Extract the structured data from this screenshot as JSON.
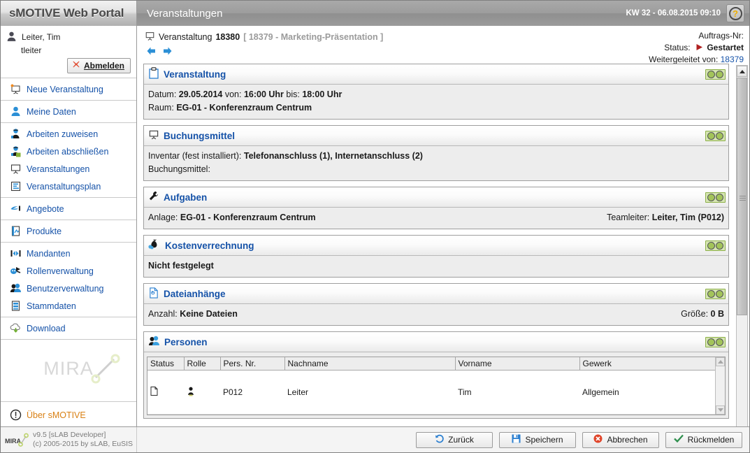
{
  "header": {
    "brand": "sMOTIVE Web Portal",
    "page_title": "Veranstaltungen",
    "datetime": "KW 32 - 06.08.2015 09:10",
    "help_glyph": "?"
  },
  "sidebar": {
    "user": {
      "name": "Leiter, Tim",
      "login": "tleiter",
      "logout_label": "Abmelden"
    },
    "groups": [
      {
        "items": [
          {
            "label": "Neue Veranstaltung",
            "icon": "new-presentation-icon"
          }
        ]
      },
      {
        "items": [
          {
            "label": "Meine Daten",
            "icon": "user-icon"
          }
        ]
      },
      {
        "items": [
          {
            "label": "Arbeiten zuweisen",
            "icon": "worker-assign-icon"
          },
          {
            "label": "Arbeiten abschließen",
            "icon": "worker-complete-icon"
          },
          {
            "label": "Veranstaltungen",
            "icon": "presentation-icon"
          },
          {
            "label": "Veranstaltungsplan",
            "icon": "plan-icon"
          }
        ]
      },
      {
        "items": [
          {
            "label": "Angebote",
            "icon": "offer-icon"
          }
        ]
      },
      {
        "items": [
          {
            "label": "Produkte",
            "icon": "product-icon"
          }
        ]
      },
      {
        "items": [
          {
            "label": "Mandanten",
            "icon": "client-icon"
          },
          {
            "label": "Rollenverwaltung",
            "icon": "roles-icon"
          },
          {
            "label": "Benutzerverwaltung",
            "icon": "users-icon"
          },
          {
            "label": "Stammdaten",
            "icon": "masterdata-icon"
          }
        ]
      },
      {
        "items": [
          {
            "label": "Download",
            "icon": "download-icon"
          }
        ]
      }
    ],
    "watermark": "MIRA",
    "about": {
      "label": "Über sMOTIVE",
      "icon": "info-icon"
    }
  },
  "breadcrumb": {
    "prefix": "Veranstaltung",
    "id": "18380",
    "context": "[ 18379 - Marketing-Präsentation ]"
  },
  "meta": {
    "order_label": "Auftrags-Nr:",
    "order_value": "",
    "status_label": "Status:",
    "status_value": "Gestartet",
    "forwarded_label": "Weitergeleitet von:",
    "forwarded_value": "18379"
  },
  "panels": [
    {
      "key": "veranstaltung",
      "title": "Veranstaltung",
      "icon": "clipboard-icon",
      "toggle": "og-toggle-icon",
      "lines": [
        {
          "type": "kv-multi",
          "parts": [
            {
              "label": "Datum:",
              "value": "29.05.2014"
            },
            {
              "label": "von:",
              "value": "16:00 Uhr"
            },
            {
              "label": "bis:",
              "value": "18:00 Uhr"
            }
          ]
        },
        {
          "type": "kv",
          "label": "Raum:",
          "value": "EG-01 - Konferenzraum Centrum"
        }
      ]
    },
    {
      "key": "buchungsmittel",
      "title": "Buchungsmittel",
      "icon": "presentation-icon",
      "toggle": "og-toggle-icon",
      "lines": [
        {
          "type": "kv",
          "label": "Inventar (fest installiert):",
          "value": "Telefonanschluss (1), Internetanschluss (2)"
        },
        {
          "type": "kv",
          "label": "Buchungsmittel:",
          "value": ""
        }
      ]
    },
    {
      "key": "aufgaben",
      "title": "Aufgaben",
      "icon": "wrench-icon",
      "toggle": "og-toggle-icon",
      "row": {
        "left_label": "Anlage:",
        "left_value": "EG-01 - Konferenzraum Centrum",
        "right_label": "Teamleiter:",
        "right_value": "Leiter, Tim (P012)"
      }
    },
    {
      "key": "kostenverrechnung",
      "title": "Kostenverrechnung",
      "icon": "moneybag-icon",
      "toggle": "og-toggle-icon",
      "note": "Nicht festgelegt"
    },
    {
      "key": "dateianhaenge",
      "title": "Dateianhänge",
      "icon": "attachment-icon",
      "toggle": "og-toggle-icon",
      "row": {
        "left_label": "Anzahl:",
        "left_value": "Keine Dateien",
        "right_label": "Größe:",
        "right_value": "0 B"
      }
    },
    {
      "key": "personen",
      "title": "Personen",
      "icon": "people-icon",
      "toggle": "og-toggle-icon",
      "table": {
        "columns": [
          "Status",
          "Rolle",
          "Pers. Nr.",
          "Nachname",
          "Vorname",
          "Gewerk"
        ],
        "rows": [
          {
            "status": "doc-icon",
            "role": "person-icon",
            "pers_nr": "P012",
            "nachname": "Leiter",
            "vorname": "Tim",
            "gewerk": "Allgemein"
          }
        ]
      }
    }
  ],
  "footer": {
    "version": "v9.5 [sLAB Developer]",
    "copyright": "(c) 2005-2015 by sLAB, EuSIS",
    "logo": "MIRA",
    "buttons": [
      {
        "label": "Zurück",
        "icon": "back-arrow-icon"
      },
      {
        "label": "Speichern",
        "icon": "save-disk-icon"
      },
      {
        "label": "Abbrechen",
        "icon": "cancel-x-icon"
      },
      {
        "label": "Rückmelden",
        "icon": "check-icon"
      }
    ]
  },
  "colors": {
    "link": "#1552a8",
    "accent_orange": "#d98014",
    "status_red": "#b02020",
    "toggle_green": "#a3c45a",
    "titlebar_gray": "#9a9a9a"
  }
}
